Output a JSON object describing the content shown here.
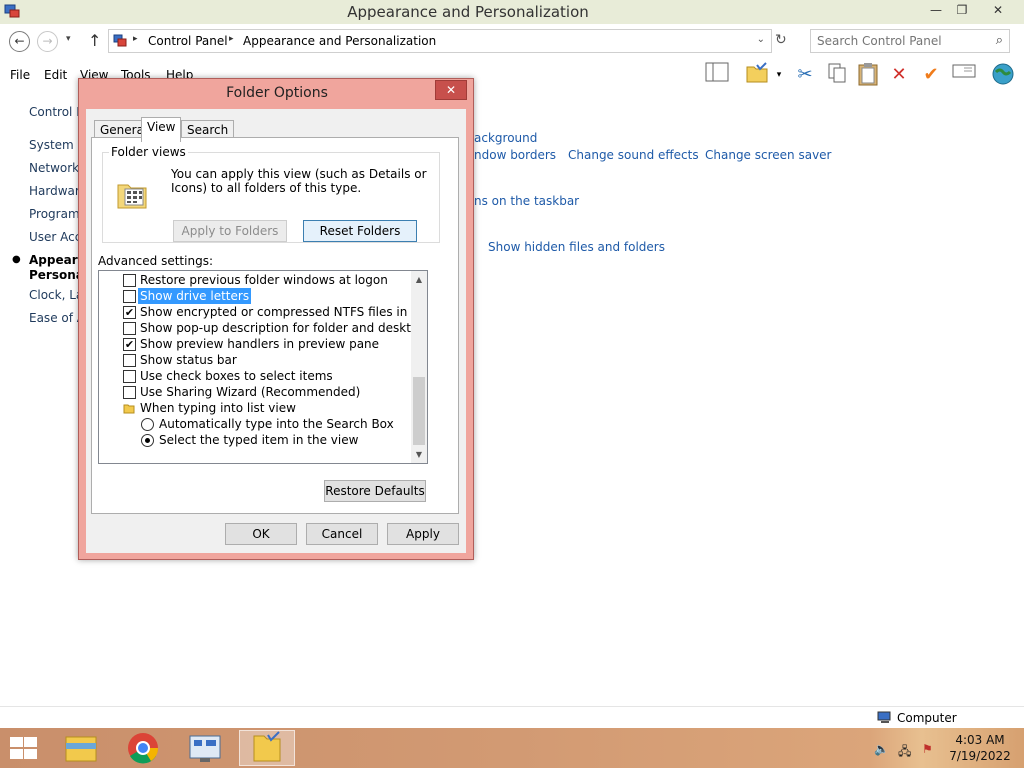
{
  "window": {
    "title": "Appearance and Personalization",
    "minimize": "—",
    "maximize": "❐",
    "close": "✕"
  },
  "nav": {
    "back": "←",
    "forward": "→",
    "recent": "▾",
    "up": "↑"
  },
  "address": {
    "crumbs": [
      "Control Panel",
      "Appearance and Personalization"
    ],
    "separator": "▸",
    "dropdown": "⌄",
    "refresh": "↻"
  },
  "search": {
    "placeholder": "Search Control Panel",
    "icon": "⌕"
  },
  "menu": [
    "File",
    "Edit",
    "View",
    "Tools",
    "Help"
  ],
  "toolbar_icons": [
    "layout-pane-icon",
    "properties-icon",
    "cut-icon",
    "copy-icon",
    "paste-icon",
    "delete-icon",
    "check-icon",
    "rename-icon",
    "globe-icon"
  ],
  "sidebar": {
    "items": [
      "Control P",
      "System ar",
      "Network",
      "Hardware",
      "Programs",
      "User Acco",
      "Appearar",
      "Personali",
      "Clock, La",
      "Ease of A"
    ]
  },
  "main_links": {
    "background": "ackground",
    "window_borders": "ndow borders",
    "change_sound": "Change sound effects",
    "change_screensaver": "Change screen saver",
    "icons_taskbar": "ns on the taskbar",
    "show_hidden": "Show hidden files and folders"
  },
  "status": {
    "computer": "Computer"
  },
  "taskbar": {
    "apps": [
      "file-explorer-icon",
      "chrome-icon",
      "control-panel-icon",
      "folder-options-icon"
    ],
    "time": "4:03 AM",
    "date": "7/19/2022"
  },
  "dialog": {
    "title": "Folder Options",
    "close": "✕",
    "tabs": [
      "General",
      "View",
      "Search"
    ],
    "active_tab": "View",
    "folder_views": {
      "legend": "Folder views",
      "description": "You can apply this view (such as Details or Icons) to all folders of this type.",
      "apply_button": "Apply to Folders",
      "reset_button": "Reset Folders"
    },
    "advanced_label": "Advanced settings:",
    "settings": [
      {
        "type": "checkbox",
        "label": "Restore previous folder windows at logon",
        "checked": false
      },
      {
        "type": "checkbox",
        "label": "Show drive letters",
        "checked": false,
        "selected": true
      },
      {
        "type": "checkbox",
        "label": "Show encrypted or compressed NTFS files in color",
        "checked": true
      },
      {
        "type": "checkbox",
        "label": "Show pop-up description for folder and desktop items",
        "checked": false
      },
      {
        "type": "checkbox",
        "label": "Show preview handlers in preview pane",
        "checked": true
      },
      {
        "type": "checkbox",
        "label": "Show status bar",
        "checked": false
      },
      {
        "type": "checkbox",
        "label": "Use check boxes to select items",
        "checked": false
      },
      {
        "type": "checkbox",
        "label": "Use Sharing Wizard (Recommended)",
        "checked": false
      },
      {
        "type": "folder",
        "label": "When typing into list view"
      },
      {
        "type": "radio",
        "label": "Automatically type into the Search Box",
        "checked": false
      },
      {
        "type": "radio",
        "label": "Select the typed item in the view",
        "checked": true
      }
    ],
    "restore_defaults": "Restore Defaults",
    "ok": "OK",
    "cancel": "Cancel",
    "apply": "Apply",
    "scroll_up": "▲",
    "scroll_down": "▼"
  }
}
